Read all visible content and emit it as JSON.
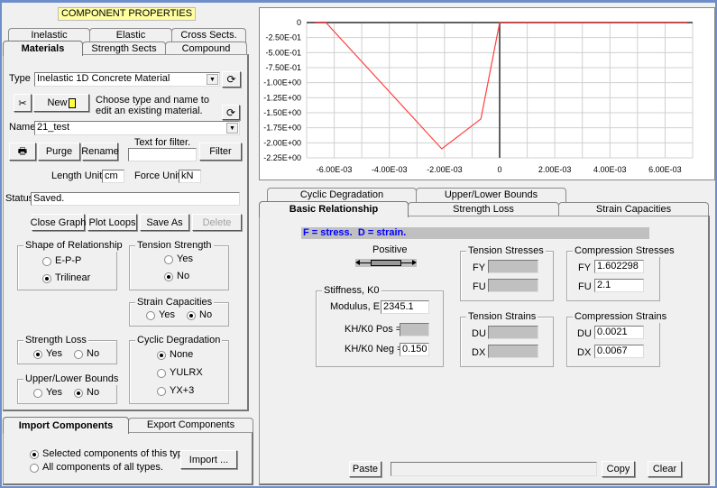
{
  "header": {
    "title": "COMPONENT PROPERTIES"
  },
  "top_tabs": {
    "row1": [
      "Inelastic",
      "Elastic",
      "Cross Sects."
    ],
    "row2": [
      "Materials",
      "Strength Sects",
      "Compound"
    ],
    "selected": "Materials"
  },
  "materials": {
    "type_label": "Type",
    "type_value": "Inelastic 1D Concrete Material",
    "new_label": "New",
    "hint": "Choose type and name to edit an existing material.",
    "name_label": "Name",
    "name_value": "21_test",
    "purge": "Purge",
    "rename": "Rename",
    "filter_label": "Text for filter.",
    "filter_value": "",
    "filter": "Filter",
    "length_unit_label": "Length Unit",
    "length_unit": "cm",
    "force_unit_label": "Force Unit",
    "force_unit": "kN",
    "status_label": "Status",
    "status": "Saved.",
    "close_graph": "Close Graph",
    "plot_loops": "Plot Loops",
    "save_as": "Save As",
    "delete": "Delete",
    "shape": {
      "title": "Shape of Relationship",
      "options": [
        "E-P-P",
        "Trilinear"
      ],
      "selected": "Trilinear"
    },
    "tension": {
      "title": "Tension Strength",
      "options": [
        "Yes",
        "No"
      ],
      "selected": "No"
    },
    "strain_cap": {
      "title": "Strain Capacities",
      "options": [
        "Yes",
        "No"
      ],
      "selected": "No"
    },
    "strength_loss": {
      "title": "Strength Loss",
      "options": [
        "Yes",
        "No"
      ],
      "selected": "Yes"
    },
    "bounds": {
      "title": "Upper/Lower Bounds",
      "options": [
        "Yes",
        "No"
      ],
      "selected": "No"
    },
    "cyclic": {
      "title": "Cyclic Degradation",
      "options": [
        "None",
        "YULRX",
        "YX+3"
      ],
      "selected": "None"
    }
  },
  "import": {
    "tabs": [
      "Import Components",
      "Export Components"
    ],
    "selected": "Import Components",
    "options": [
      "Selected components of this type.",
      "All components of all types."
    ],
    "selected_option": "Selected components of this type.",
    "button": "Import ..."
  },
  "chart_data": {
    "type": "line",
    "x_ticks": [
      "-6.00E-03",
      "-4.00E-03",
      "-2.00E-03",
      "0",
      "2.00E-03",
      "4.00E-03",
      "6.00E-03"
    ],
    "x_tick_values": [
      -0.006,
      -0.004,
      -0.002,
      0,
      0.002,
      0.004,
      0.006
    ],
    "y_ticks": [
      "0",
      "-2.50E-01",
      "-5.00E-01",
      "-7.50E-01",
      "-1.00E+00",
      "-1.25E+00",
      "-1.50E+00",
      "-1.75E+00",
      "-2.00E+00",
      "-2.25E+00"
    ],
    "y_tick_values": [
      0,
      -0.25,
      -0.5,
      -0.75,
      -1.0,
      -1.25,
      -1.5,
      -1.75,
      -2.0,
      -2.25
    ],
    "xlim": [
      -0.007,
      0.007
    ],
    "ylim": [
      -2.25,
      0
    ],
    "grid": true,
    "series": [
      {
        "color": "#ff4040",
        "x": [
          -0.0067,
          -0.0063,
          -0.0021,
          -0.00068,
          0,
          0.0068
        ],
        "y": [
          0,
          0,
          -2.1,
          -1.602298,
          0,
          0
        ]
      }
    ]
  },
  "props": {
    "tabs_row1": [
      "Cyclic Degradation",
      "Upper/Lower Bounds"
    ],
    "tabs_row2": [
      "Basic Relationship",
      "Strength Loss",
      "Strain Capacities"
    ],
    "selected": "Basic Relationship",
    "note": "F = stress.  D = strain.",
    "positive": "Positive",
    "stiffness": {
      "title": "Stiffness, K0",
      "modulus_label": "Modulus, E",
      "modulus": "2345.1",
      "kh_pos_label": "KH/K0 Pos =",
      "kh_pos": "",
      "kh_neg_label": "KH/K0 Neg =",
      "kh_neg": "0.150"
    },
    "tension_stresses": {
      "title": "Tension Stresses",
      "fy_label": "FY",
      "fy": "",
      "fu_label": "FU",
      "fu": ""
    },
    "compression_stresses": {
      "title": "Compression Stresses",
      "fy_label": "FY",
      "fy": "1.602298",
      "fu_label": "FU",
      "fu": "2.1"
    },
    "tension_strains": {
      "title": "Tension Strains",
      "du_label": "DU",
      "du": "",
      "dx_label": "DX",
      "dx": ""
    },
    "compression_strains": {
      "title": "Compression Strains",
      "du_label": "DU",
      "du": "0.0021",
      "dx_label": "DX",
      "dx": "0.0067"
    },
    "paste": "Paste",
    "paste_field": "",
    "copy": "Copy",
    "clear": "Clear"
  },
  "colors": {
    "accent_blue": "#0000ff",
    "title_yellow": "#ffffa0",
    "curve": "#ff4040"
  }
}
